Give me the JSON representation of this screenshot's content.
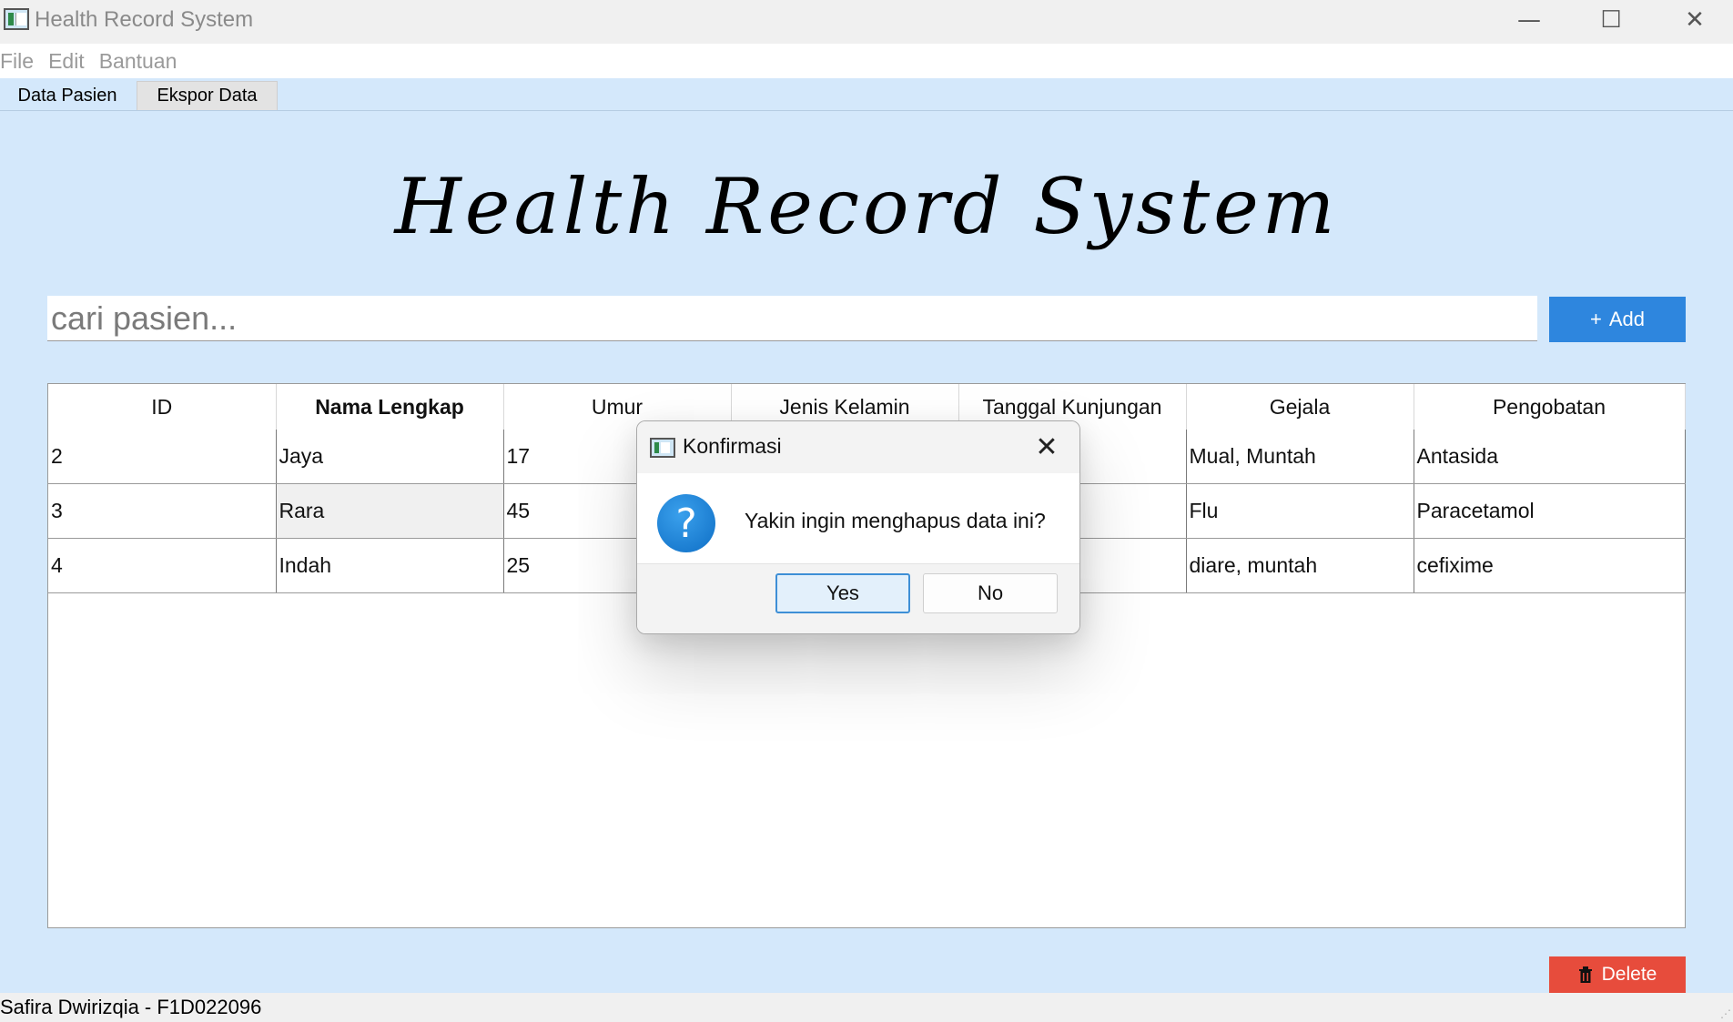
{
  "window": {
    "title": "Health Record System",
    "minimize": "—",
    "maximize": "☐",
    "close": "✕"
  },
  "menu": [
    "File",
    "Edit",
    "Bantuan"
  ],
  "tabs": [
    {
      "label": "Data Pasien",
      "active": true
    },
    {
      "label": "Ekspor Data",
      "active": false
    }
  ],
  "main": {
    "heading": "Health Record System",
    "search_placeholder": "cari pasien...",
    "add_label": "Add",
    "delete_label": "Delete"
  },
  "table": {
    "headers": [
      "ID",
      "Nama Lengkap",
      "Umur",
      "Jenis Kelamin",
      "Tanggal Kunjungan",
      "Gejala",
      "Pengobatan"
    ],
    "rows": [
      [
        "2",
        "Jaya",
        "17",
        "",
        "",
        "Mual, Muntah",
        "Antasida"
      ],
      [
        "3",
        "Rara",
        "45",
        "",
        "",
        "Flu",
        "Paracetamol"
      ],
      [
        "4",
        "Indah",
        "25",
        "",
        "",
        "diare, muntah",
        "cefixime"
      ]
    ]
  },
  "dialog": {
    "title": "Konfirmasi",
    "message": "Yakin ingin menghapus data ini?",
    "yes_label": "Yes",
    "no_label": "No",
    "close": "✕",
    "icon_glyph": "?"
  },
  "status": {
    "text": "Safira Dwirizqia - F1D022096"
  },
  "colors": {
    "background": "#d4e8fb",
    "add_button": "#2e86de",
    "delete_button": "#e74c3c",
    "question_icon": "#1a7fd1"
  }
}
